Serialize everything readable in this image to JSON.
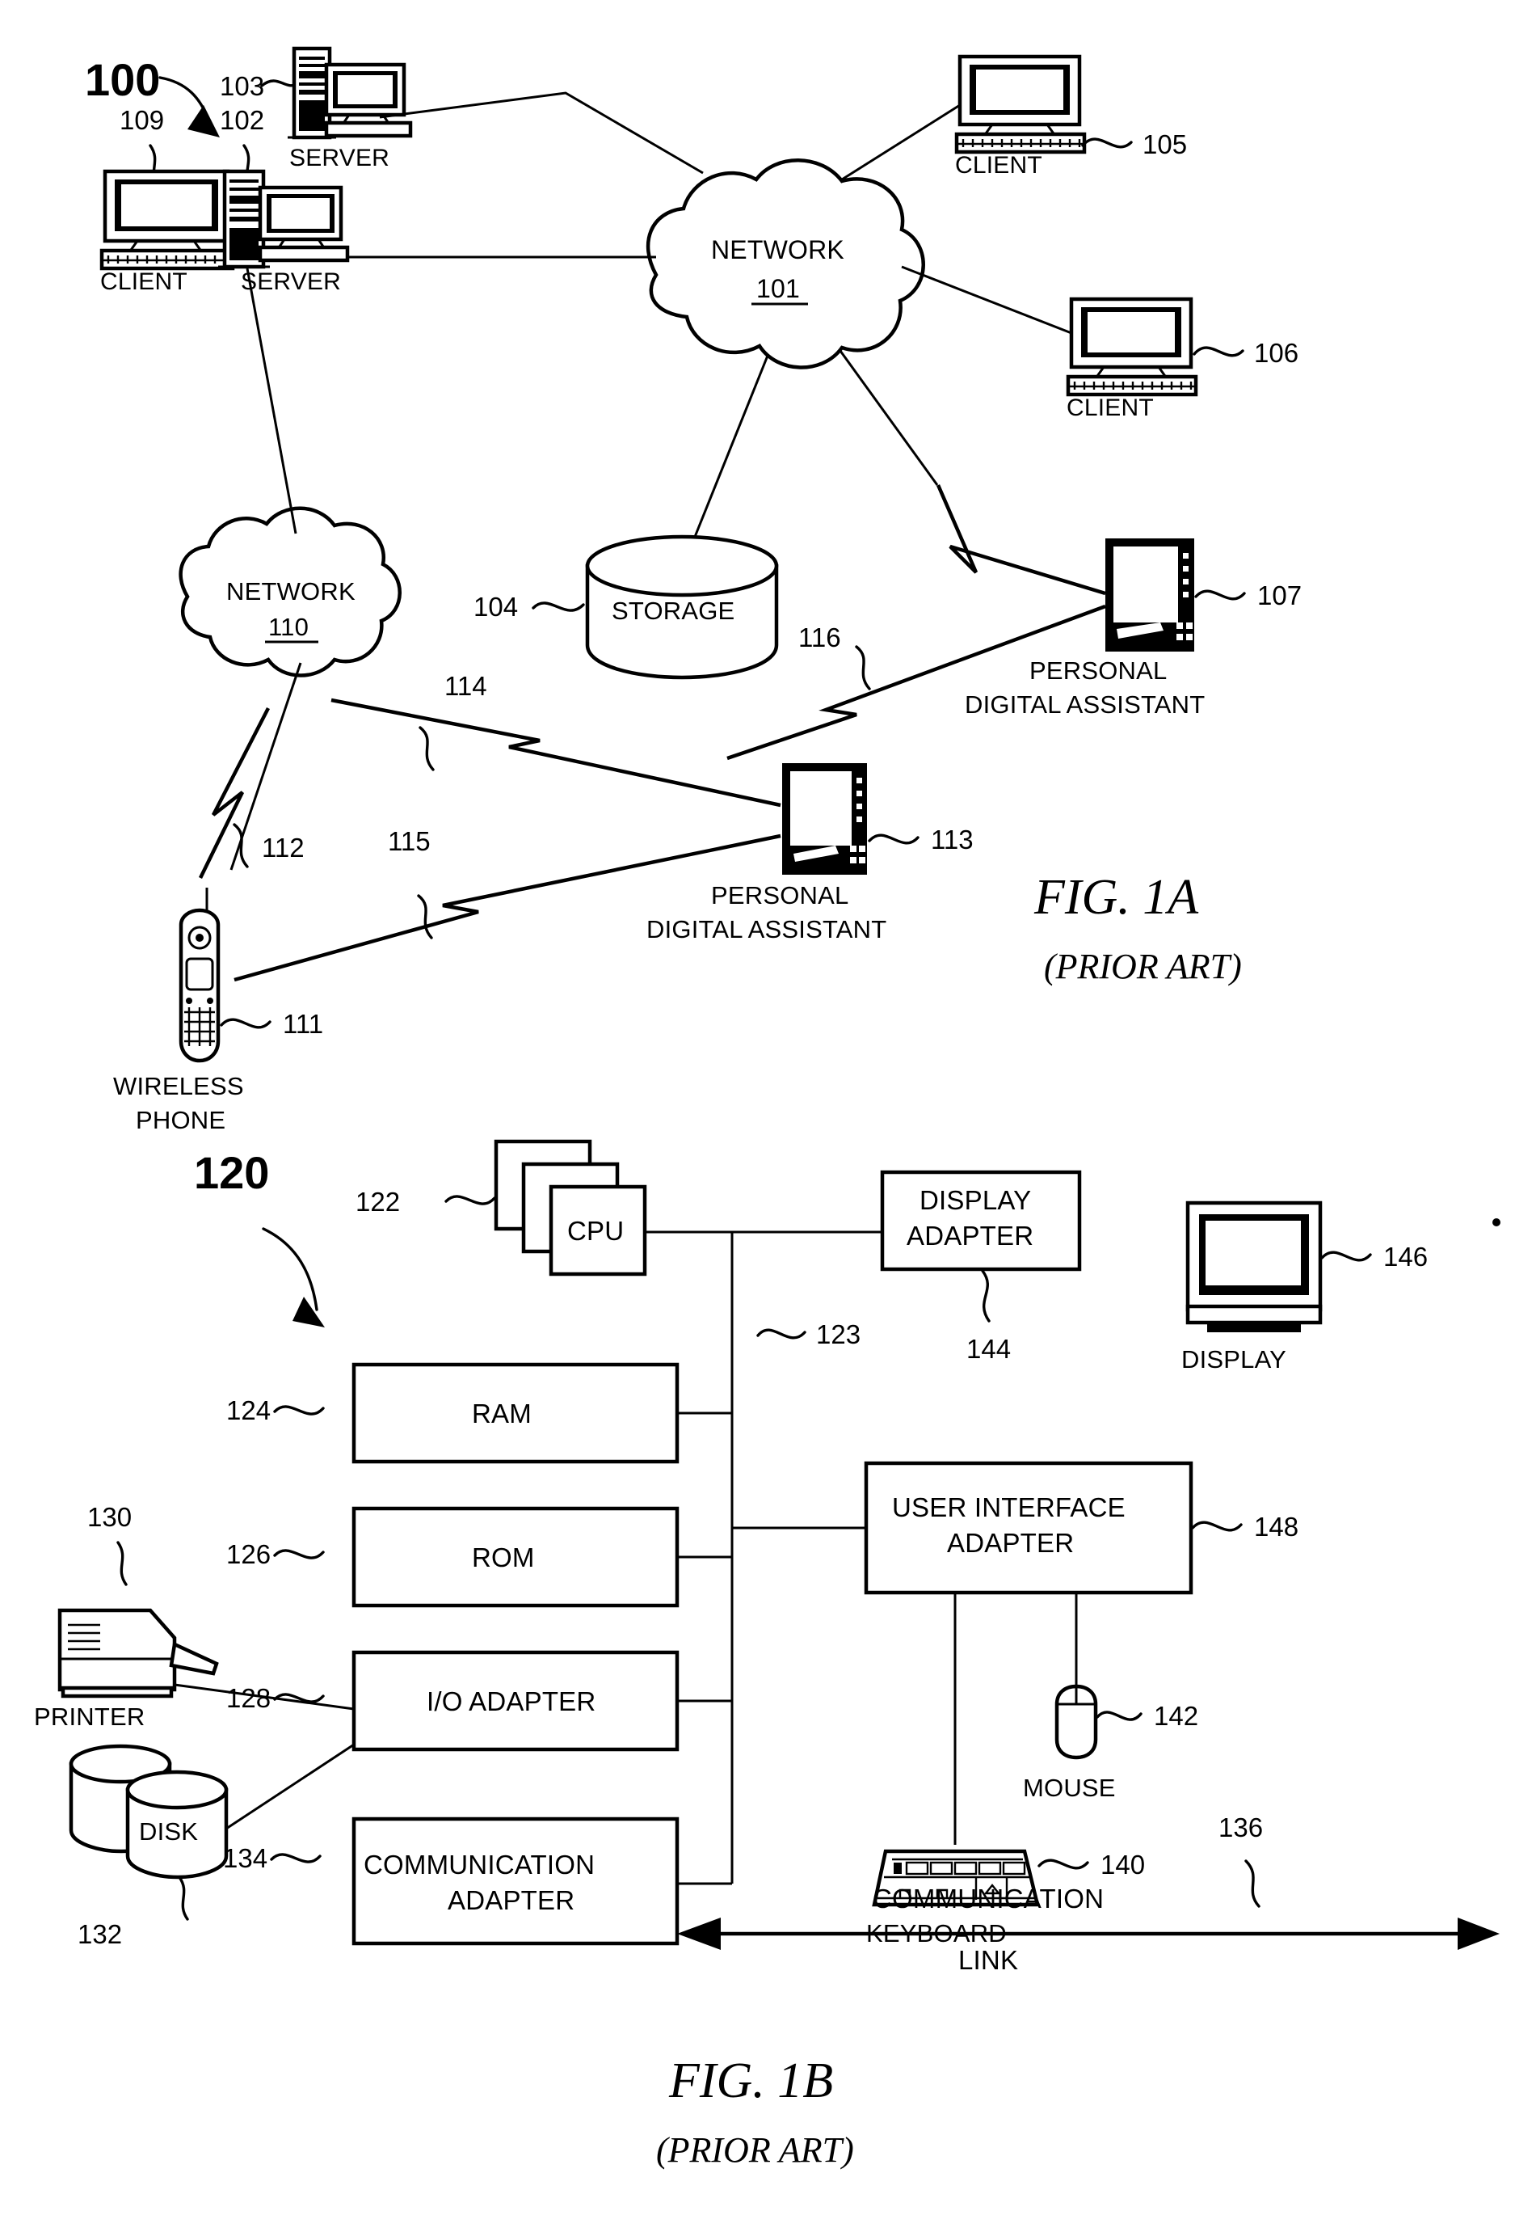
{
  "figures": [
    {
      "id": "fig-1a",
      "title": "FIG. 1A",
      "subtitle": "(PRIOR ART)",
      "system_ref": "100",
      "nodes": [
        {
          "key": "client_109",
          "label": "CLIENT",
          "ref": "109",
          "icon": "desktop-computer-icon"
        },
        {
          "key": "server_102",
          "label": "SERVER",
          "ref": "102",
          "icon": "server-tower-icon"
        },
        {
          "key": "server_103",
          "label": "SERVER",
          "ref": "103",
          "icon": "server-tower-icon"
        },
        {
          "key": "client_105",
          "label": "CLIENT",
          "ref": "105",
          "icon": "desktop-computer-icon"
        },
        {
          "key": "client_106",
          "label": "CLIENT",
          "ref": "106",
          "icon": "desktop-computer-icon"
        },
        {
          "key": "network_101",
          "label": "NETWORK",
          "ref": "101",
          "icon": "cloud-icon"
        },
        {
          "key": "network_110",
          "label": "NETWORK",
          "ref": "110",
          "icon": "cloud-icon"
        },
        {
          "key": "storage_104",
          "label": "STORAGE",
          "ref": "104",
          "icon": "cylinder-storage-icon"
        },
        {
          "key": "pda_107",
          "label": "PERSONAL DIGITAL ASSISTANT",
          "label_line1": "PERSONAL",
          "label_line2": "DIGITAL ASSISTANT",
          "ref": "107",
          "icon": "pda-icon"
        },
        {
          "key": "pda_113",
          "label": "PERSONAL DIGITAL ASSISTANT",
          "label_line1": "PERSONAL",
          "label_line2": "DIGITAL ASSISTANT",
          "ref": "113",
          "icon": "pda-icon"
        },
        {
          "key": "phone_111",
          "label": "WIRELESS PHONE",
          "label_line1": "WIRELESS",
          "label_line2": "PHONE",
          "ref": "111",
          "icon": "wireless-phone-icon"
        }
      ],
      "wireless_links": [
        {
          "key": "link_112",
          "ref": "112"
        },
        {
          "key": "link_114",
          "ref": "114"
        },
        {
          "key": "link_115",
          "ref": "115"
        },
        {
          "key": "link_116",
          "ref": "116"
        }
      ]
    },
    {
      "id": "fig-1b",
      "title": "FIG. 1B",
      "subtitle": "(PRIOR ART)",
      "system_ref": "120",
      "blocks": [
        {
          "key": "cpu",
          "label": "CPU",
          "ref": "122"
        },
        {
          "key": "ram",
          "label": "RAM",
          "ref": "124"
        },
        {
          "key": "rom",
          "label": "ROM",
          "ref": "126"
        },
        {
          "key": "io_adapter",
          "label": "I/O ADAPTER",
          "ref": "128"
        },
        {
          "key": "communication_adapter",
          "label_line1": "COMMUNICATION",
          "label_line2": "ADAPTER",
          "ref": "134"
        },
        {
          "key": "display_adapter",
          "label_line1": "DISPLAY",
          "label_line2": "ADAPTER",
          "ref": "144"
        },
        {
          "key": "user_interface_adapter",
          "label_line1": "USER INTERFACE",
          "label_line2": "ADAPTER",
          "ref": "148"
        }
      ],
      "peripherals": [
        {
          "key": "printer",
          "label": "PRINTER",
          "ref": "130",
          "icon": "printer-icon"
        },
        {
          "key": "disk",
          "label": "DISK",
          "ref": "132",
          "icon": "disk-stack-icon"
        },
        {
          "key": "display",
          "label": "DISPLAY",
          "ref": "146",
          "icon": "crt-monitor-icon"
        },
        {
          "key": "mouse",
          "label": "MOUSE",
          "ref": "142",
          "icon": "mouse-icon"
        },
        {
          "key": "keyboard",
          "label": "KEYBOARD",
          "ref": "140",
          "icon": "keyboard-icon"
        }
      ],
      "bus": {
        "ref": "123"
      },
      "communication_link": {
        "label_line1": "COMMUNICATION",
        "label_line2": "LINK",
        "ref": "136"
      }
    }
  ]
}
